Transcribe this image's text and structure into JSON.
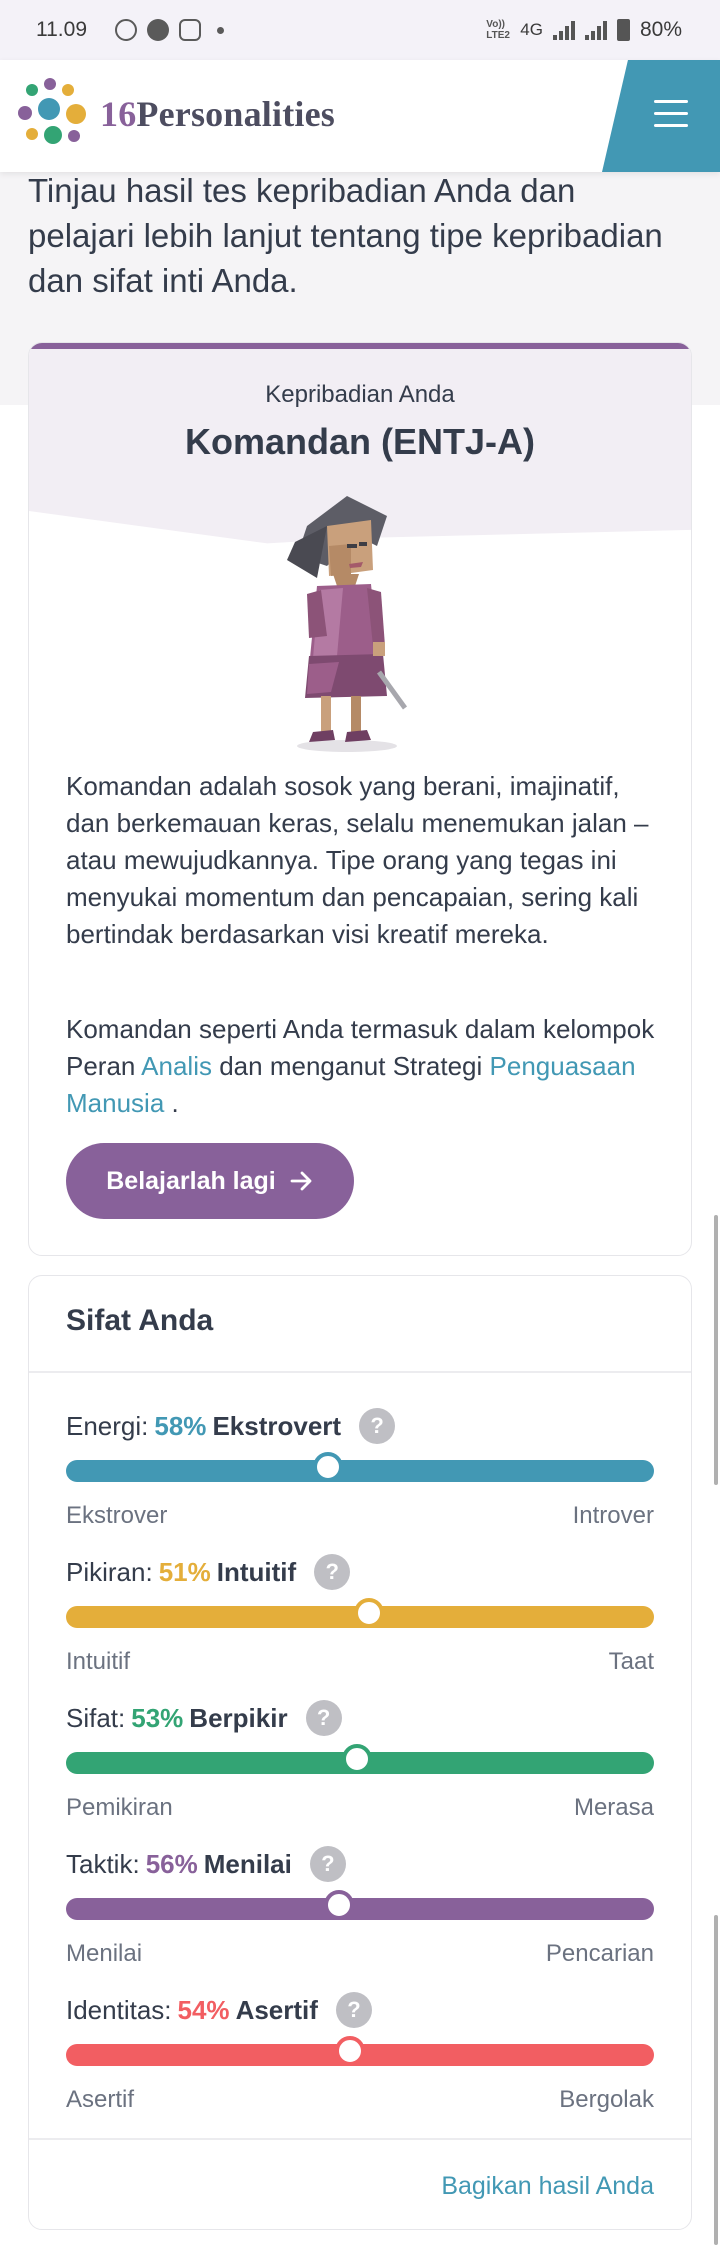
{
  "status_bar": {
    "time": "11.09",
    "network_small": "Vo)) LTE2",
    "network": "4G",
    "battery": "80%"
  },
  "header": {
    "logo_number": "16",
    "logo_text": "Personalities"
  },
  "intro": {
    "text": "Tinjau hasil tes kepribadian Anda dan pelajari lebih lanjut tentang tipe kepribadian dan sifat inti Anda."
  },
  "personality": {
    "label": "Kepribadian Anda",
    "title": "Komandan (ENTJ-A)",
    "description": "Komandan adalah sosok yang berani, imajinatif, dan berkemauan keras, selalu menemukan jalan – atau mewujudkannya. Tipe orang yang tegas ini menyukai momentum dan pencapaian, sering kali bertindak berdasarkan visi kreatif mereka.",
    "role_text_1": "Komandan seperti Anda termasuk dalam kelompok Peran ",
    "role_link": "Analis",
    "role_text_2": " dan menganut Strategi ",
    "strategy_link": "Penguasaan Manusia",
    "role_text_3": " .",
    "learn_button": "Belajarlah lagi"
  },
  "traits": {
    "title": "Sifat Anda",
    "items": [
      {
        "label": "Energi:",
        "percent": "58%",
        "name": "Ekstrovert",
        "left": "Ekstrover",
        "right": "Introver",
        "color": "#4298b4",
        "position": 0.445
      },
      {
        "label": "Pikiran:",
        "percent": "51%",
        "name": "Intuitif",
        "left": "Intuitif",
        "right": "Taat",
        "color": "#e4ae3a",
        "position": 0.515
      },
      {
        "label": "Sifat:",
        "percent": "53%",
        "name": "Berpikir",
        "left": "Pemikiran",
        "right": "Merasa",
        "color": "#33a474",
        "position": 0.495
      },
      {
        "label": "Taktik:",
        "percent": "56%",
        "name": "Menilai",
        "left": "Menilai",
        "right": "Pencarian",
        "color": "#88619a",
        "position": 0.465
      },
      {
        "label": "Identitas:",
        "percent": "54%",
        "name": "Asertif",
        "left": "Asertif",
        "right": "Bergolak",
        "color": "#f25e62",
        "position": 0.483
      }
    ],
    "help_symbol": "?",
    "share_link": "Bagikan hasil Anda"
  }
}
